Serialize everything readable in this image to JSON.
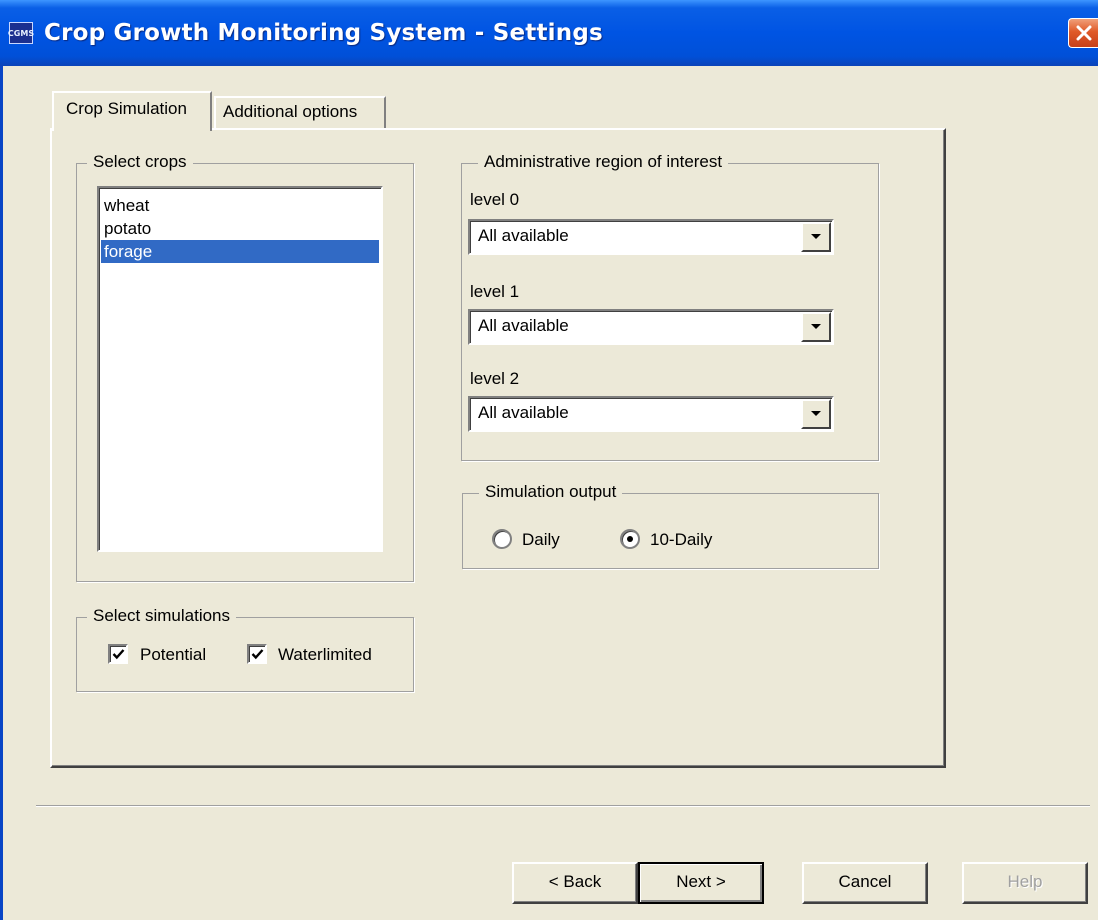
{
  "window": {
    "title": "Crop Growth Monitoring System - Settings",
    "icon_text": "CGMS",
    "icon": "app-icon",
    "close_icon": "close-icon"
  },
  "tabs": [
    {
      "label": "Crop Simulation",
      "active": true
    },
    {
      "label": "Additional options",
      "active": false
    }
  ],
  "crops": {
    "legend": "Select crops",
    "items": [
      "wheat",
      "potato",
      "forage"
    ],
    "selected": "forage"
  },
  "simulations": {
    "legend": "Select simulations",
    "options": [
      {
        "label": "Potential",
        "checked": true
      },
      {
        "label": "Waterlimited",
        "checked": true
      }
    ]
  },
  "region": {
    "legend": "Administrative region of interest",
    "levels": [
      {
        "label": "level 0",
        "value": "All available"
      },
      {
        "label": "level 1",
        "value": "All available"
      },
      {
        "label": "level 2",
        "value": "All available"
      }
    ]
  },
  "output": {
    "legend": "Simulation output",
    "options": [
      {
        "label": "Daily",
        "selected": false
      },
      {
        "label": "10-Daily",
        "selected": true
      }
    ]
  },
  "buttons": {
    "back": "< Back",
    "next": "Next >",
    "cancel": "Cancel",
    "help": "Help"
  },
  "colors": {
    "titlebar": "#0054e3",
    "selection": "#316ac5",
    "face": "#ece9d8",
    "close": "#e05a28"
  }
}
